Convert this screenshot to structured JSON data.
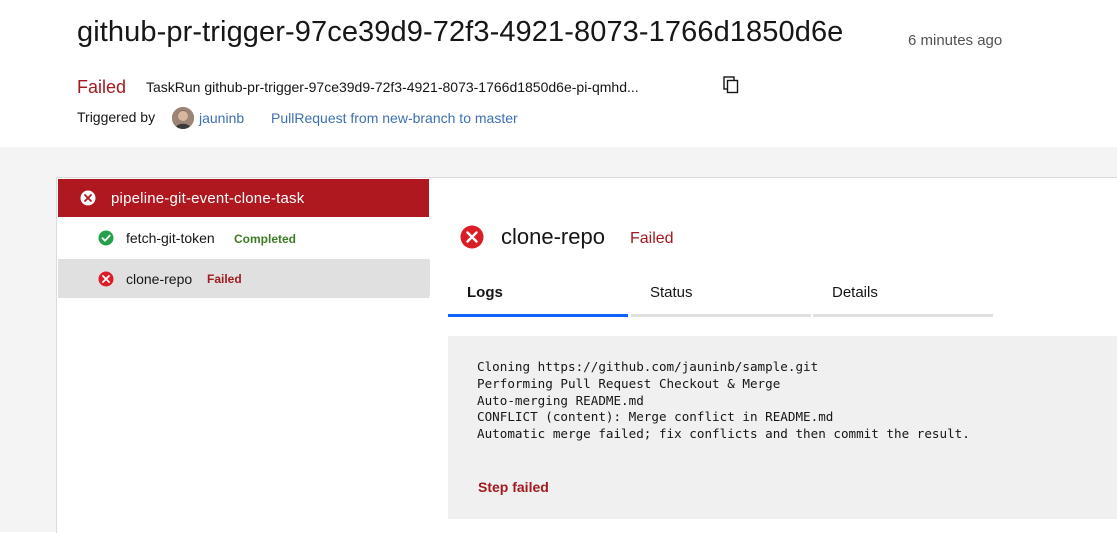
{
  "header": {
    "title": "github-pr-trigger-97ce39d9-72f3-4921-8073-1766d1850d6e",
    "time_ago": "6 minutes ago",
    "status": "Failed",
    "taskrun": "TaskRun github-pr-trigger-97ce39d9-72f3-4921-8073-1766d1850d6e-pi-qmhd...",
    "triggered_by_label": "Triggered by",
    "user": "jauninb",
    "trigger_link": "PullRequest from new-branch to master"
  },
  "tasklist": {
    "task": {
      "name": "pipeline-git-event-clone-task",
      "status": "failed"
    },
    "steps": [
      {
        "name": "fetch-git-token",
        "status": "Completed"
      },
      {
        "name": "clone-repo",
        "status": "Failed"
      }
    ]
  },
  "detail": {
    "title": "clone-repo",
    "status": "Failed",
    "tabs": [
      "Logs",
      "Status",
      "Details"
    ],
    "active_tab": "Logs",
    "log_lines": "Cloning https://github.com/jauninb/sample.git\nPerforming Pull Request Checkout & Merge\nAuto-merging README.md\nCONFLICT (content): Merge conflict in README.md\nAutomatic merge failed; fix conflicts and then commit the result.",
    "step_result": "Step failed"
  },
  "colors": {
    "failed": "#a2191f",
    "failed_banner": "#b0181f",
    "success": "#24a148",
    "link": "#3d70b2",
    "active_tab": "#0f62fe"
  },
  "icons": {
    "error": "error-filled-icon",
    "success": "checkmark-filled-icon",
    "copy": "copy-icon"
  }
}
